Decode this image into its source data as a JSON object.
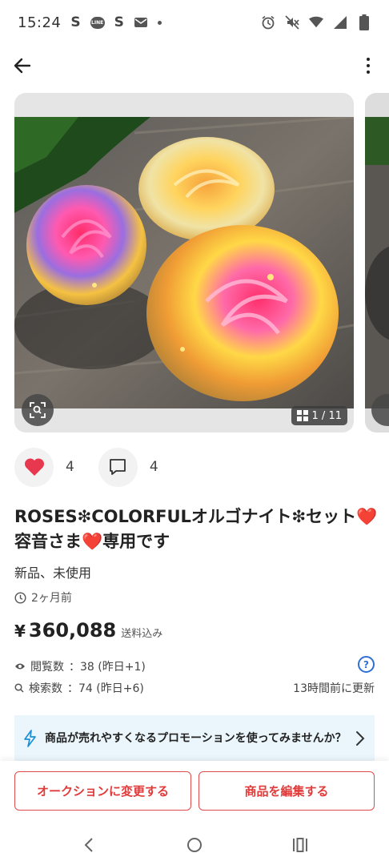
{
  "status_bar": {
    "time": "15:24",
    "icons": [
      "s-icon",
      "line-icon",
      "s-icon",
      "mail-icon",
      "dot-icon",
      "alarm-icon",
      "mute-icon",
      "wifi-icon",
      "signal-icon",
      "battery-icon"
    ]
  },
  "app_bar": {
    "back_icon": "arrow-left-icon",
    "menu_icon": "more-vertical-icon"
  },
  "gallery": {
    "counter": "1 / 11"
  },
  "reactions": {
    "likes": "4",
    "comments": "4",
    "like_color": "#e8384f"
  },
  "item": {
    "title": "ROSES❇︎COLORFULオルゴナイト❇︎セット❤️容音さま❤️専用です",
    "condition": "新品、未使用",
    "posted": "2ヶ月前",
    "price_symbol": "¥",
    "price": "360,088",
    "shipping": "送料込み"
  },
  "stats": {
    "views_label": "閲覧数",
    "views_value": "：38 (昨日+1)",
    "searches_label": "検索数",
    "searches_value": "：74 (昨日+6)",
    "updated": "13時間前に更新"
  },
  "promo": {
    "text": "商品が売れやすくなるプロモーションを使ってみませんか？"
  },
  "actions": {
    "auction_label": "オークションに変更する",
    "edit_label": "商品を編集する"
  },
  "colors": {
    "accent_red": "#e03a3a",
    "help_blue": "#2f6fd6",
    "promo_bg": "#eaf6fc"
  }
}
